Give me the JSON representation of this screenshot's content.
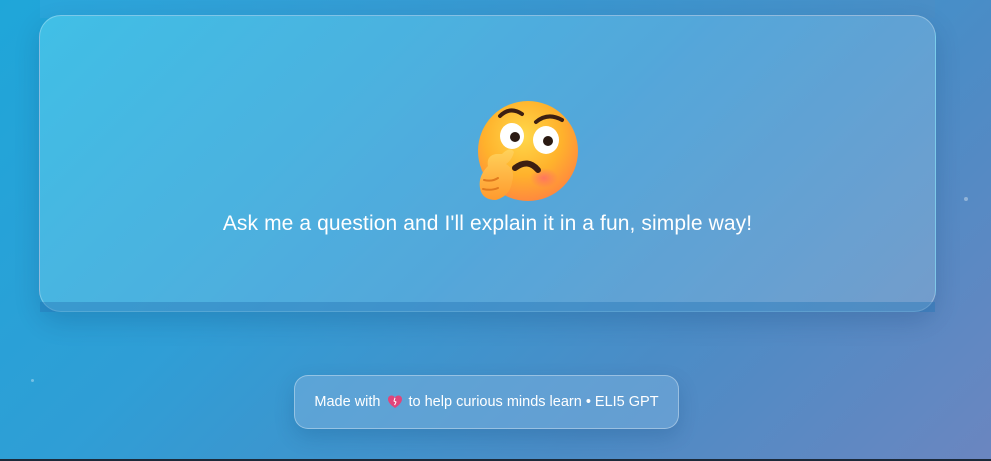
{
  "main": {
    "emoji_icon": "thinking-face-icon",
    "message": "Ask me a question and I'll explain it in a fun, simple way!"
  },
  "footer": {
    "prefix": "Made with",
    "heart_icon": "heart-icon",
    "suffix": "to help curious minds learn • ELI5 GPT"
  },
  "colors": {
    "background_start": "#1fa6d9",
    "background_end": "#6b86c0",
    "heart": "#e0457b"
  }
}
